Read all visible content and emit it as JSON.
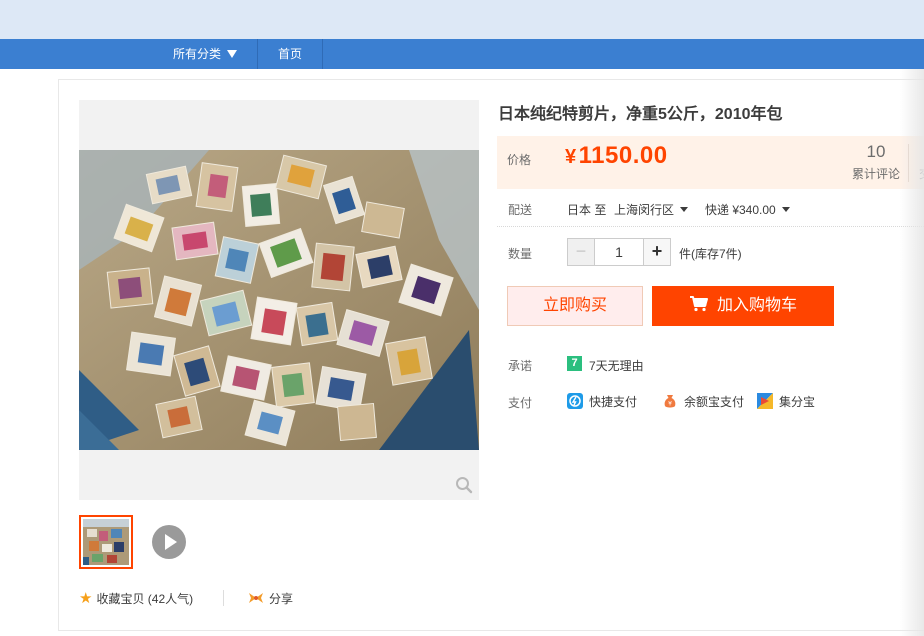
{
  "nav": {
    "all_categories": "所有分类",
    "home": "首页"
  },
  "product": {
    "title": "日本纯纪特剪片，净重5公斤，2010年包"
  },
  "price": {
    "label": "价格",
    "currency": "¥",
    "value": "1150.00",
    "reviews_count": "10",
    "reviews_label": "累计评论",
    "extra_label_partial": "交"
  },
  "shipping": {
    "label": "配送",
    "from": "日本 至",
    "to": "上海闵行区",
    "fee": "快递 ¥340.00"
  },
  "quantity": {
    "label": "数量",
    "minus": "−",
    "value": "1",
    "plus": "+",
    "stock": "件(库存7件)"
  },
  "actions": {
    "buy_now": "立即购买",
    "add_to_cart": "加入购物车"
  },
  "promise": {
    "label": "承诺",
    "badge": "7",
    "text": "7天无理由"
  },
  "payment": {
    "label": "支付",
    "methods": [
      "快捷支付",
      "余额宝支付",
      "集分宝"
    ]
  },
  "gallery": {
    "favorite": "收藏宝贝 (42人气)",
    "share": "分享"
  },
  "colors": {
    "nav_blue": "#3b7fd1",
    "price_orange": "#ff4400",
    "price_bg": "#fff2e8",
    "badge_green": "#2bbf7f"
  }
}
